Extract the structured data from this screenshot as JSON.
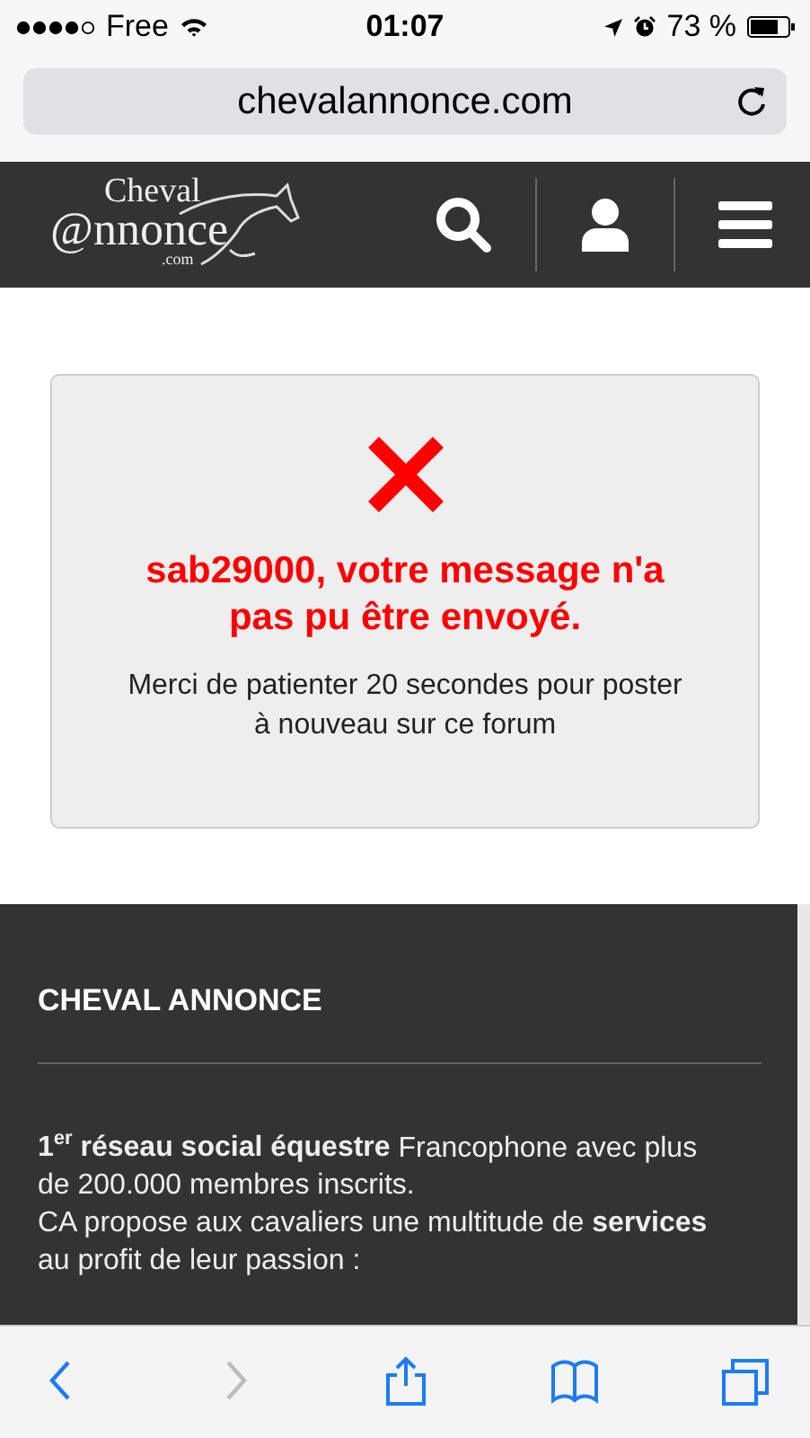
{
  "status_bar": {
    "carrier": "Free",
    "time": "01:07",
    "battery": "73 %"
  },
  "address_bar": {
    "url": "chevalannonce.com"
  },
  "site_header": {
    "logo": {
      "top": "Cheval",
      "main": "@nnonce",
      "sub": ".com"
    }
  },
  "alert": {
    "message": "sab29000, votre message n'a pas pu être envoyé.",
    "detail": "Merci de patienter 20 secondes pour poster à nouveau sur ce forum"
  },
  "footer": {
    "heading": "CHEVAL ANNONCE",
    "paragraphs": [
      "**1$^{er}$ réseau social équestre** Francophone avec plus de 200.000 membres inscrits.",
      "CA propose aux cavaliers une multitude de **services** au profit de leur passion :"
    ]
  },
  "toolbar": {
    "buttons": [
      {
        "kind": "back",
        "disabled": false
      },
      {
        "kind": "forward",
        "disabled": true
      },
      {
        "kind": "share",
        "disabled": false
      },
      {
        "kind": "bookmarks",
        "disabled": false
      },
      {
        "kind": "tabs",
        "disabled": false
      }
    ]
  }
}
